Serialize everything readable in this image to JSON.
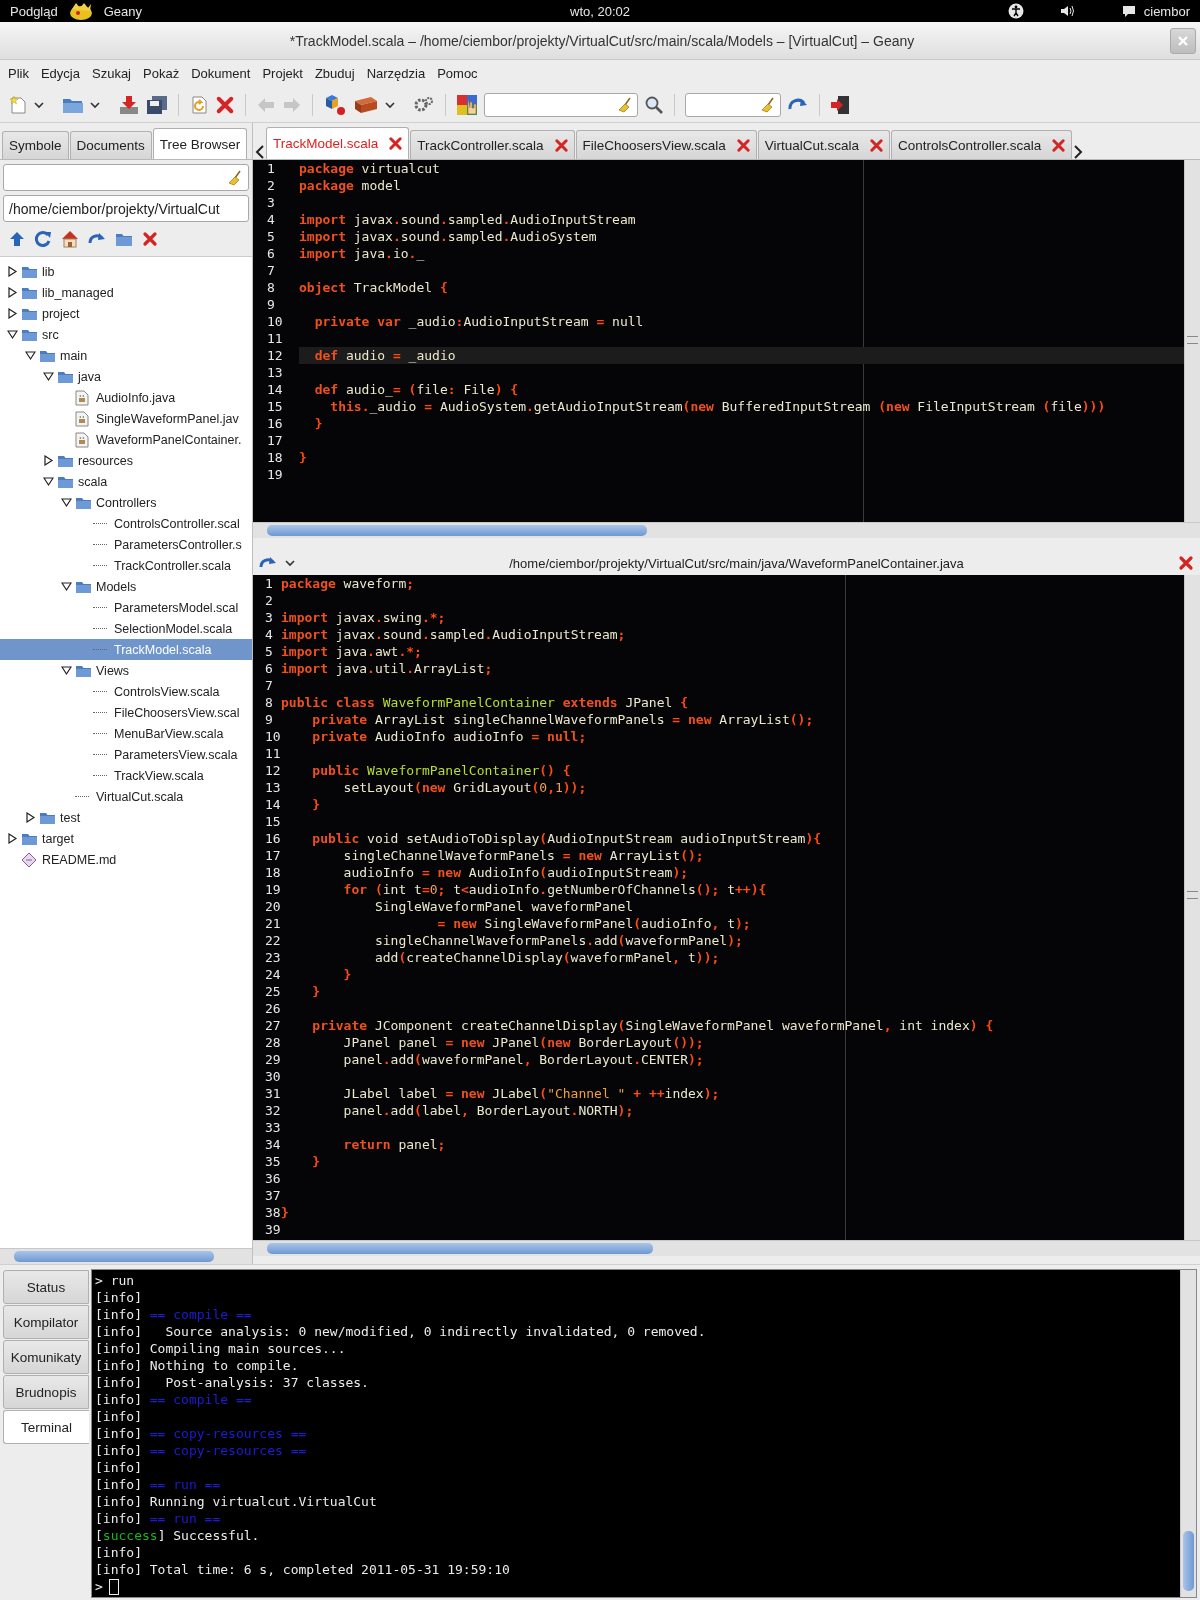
{
  "top_bar": {
    "activities": "Podgląd",
    "app_name": "Geany",
    "clock": "wto, 20:02",
    "user": "ciembor"
  },
  "window": {
    "title": "*TrackModel.scala – /home/ciembor/projekty/VirtualCut/src/main/scala/Models – [VirtualCut] – Geany"
  },
  "menu": [
    "Plik",
    "Edycja",
    "Szukaj",
    "Pokaż",
    "Dokument",
    "Projekt",
    "Zbuduj",
    "Narzędzia",
    "Pomoc"
  ],
  "sidebar": {
    "tabs": [
      {
        "label": "Symbole",
        "selected": false
      },
      {
        "label": "Documents",
        "selected": false
      },
      {
        "label": "Tree Browser",
        "selected": true
      }
    ],
    "path": "/home/ciembor/projekty/VirtualCut",
    "tree": [
      {
        "label": "lib",
        "kind": "folder",
        "expanded": false,
        "selected": false
      },
      {
        "label": "lib_managed",
        "kind": "folder",
        "expanded": false,
        "selected": false
      },
      {
        "label": "project",
        "kind": "folder",
        "expanded": false,
        "selected": false
      },
      {
        "label": "src",
        "kind": "folder",
        "expanded": true,
        "selected": false,
        "children": [
          {
            "label": "main",
            "kind": "folder",
            "expanded": true,
            "selected": false,
            "children": [
              {
                "label": "java",
                "kind": "folder",
                "expanded": true,
                "selected": false,
                "children": [
                  {
                    "label": "AudioInfo.java",
                    "kind": "java",
                    "selected": false
                  },
                  {
                    "label": "SingleWaveformPanel.jav",
                    "kind": "java",
                    "selected": false
                  },
                  {
                    "label": "WaveformPanelContainer.",
                    "kind": "java",
                    "selected": false
                  }
                ]
              },
              {
                "label": "resources",
                "kind": "folder",
                "expanded": false,
                "selected": false
              },
              {
                "label": "scala",
                "kind": "folder",
                "expanded": true,
                "selected": false,
                "children": [
                  {
                    "label": "Controllers",
                    "kind": "folder",
                    "expanded": true,
                    "selected": false,
                    "children": [
                      {
                        "label": "ControlsController.scal",
                        "kind": "scala",
                        "selected": false
                      },
                      {
                        "label": "ParametersController.s",
                        "kind": "scala",
                        "selected": false
                      },
                      {
                        "label": "TrackController.scala",
                        "kind": "scala",
                        "selected": false
                      }
                    ]
                  },
                  {
                    "label": "Models",
                    "kind": "folder",
                    "expanded": true,
                    "selected": false,
                    "children": [
                      {
                        "label": "ParametersModel.scal",
                        "kind": "scala",
                        "selected": false
                      },
                      {
                        "label": "SelectionModel.scala",
                        "kind": "scala",
                        "selected": false
                      },
                      {
                        "label": "TrackModel.scala",
                        "kind": "scala",
                        "selected": true
                      }
                    ]
                  },
                  {
                    "label": "Views",
                    "kind": "folder",
                    "expanded": true,
                    "selected": false,
                    "children": [
                      {
                        "label": "ControlsView.scala",
                        "kind": "scala",
                        "selected": false
                      },
                      {
                        "label": "FileChoosersView.scal",
                        "kind": "scala",
                        "selected": false
                      },
                      {
                        "label": "MenuBarView.scala",
                        "kind": "scala",
                        "selected": false
                      },
                      {
                        "label": "ParametersView.scala",
                        "kind": "scala",
                        "selected": false
                      },
                      {
                        "label": "TrackView.scala",
                        "kind": "scala",
                        "selected": false
                      }
                    ]
                  },
                  {
                    "label": "VirtualCut.scala",
                    "kind": "scala",
                    "selected": false
                  }
                ]
              }
            ]
          },
          {
            "label": "test",
            "kind": "folder",
            "expanded": false,
            "selected": false
          }
        ]
      },
      {
        "label": "target",
        "kind": "folder",
        "expanded": false,
        "selected": false
      },
      {
        "label": "README.md",
        "kind": "markdown",
        "selected": false
      }
    ]
  },
  "editor_tabs": [
    {
      "label": "TrackModel.scala",
      "selected": true,
      "modified": true
    },
    {
      "label": "TrackController.scala",
      "selected": false,
      "modified": false
    },
    {
      "label": "FileChoosersView.scala",
      "selected": false,
      "modified": false
    },
    {
      "label": "VirtualCut.scala",
      "selected": false,
      "modified": false
    },
    {
      "label": "ControlsController.scala",
      "selected": false,
      "modified": false
    }
  ],
  "editor": {
    "lines": [
      {
        "number": "1",
        "current": false,
        "tokens": [
          {
            "kind": "keyword",
            "text": "package"
          },
          {
            "kind": "plain",
            "text": " virtualcut"
          }
        ]
      },
      {
        "number": "2",
        "current": false,
        "tokens": [
          {
            "kind": "keyword",
            "text": "package"
          },
          {
            "kind": "plain",
            "text": " model"
          }
        ]
      },
      {
        "number": "3",
        "current": false
      },
      {
        "number": "4",
        "current": false,
        "tokens": [
          {
            "kind": "keyword",
            "text": "import"
          },
          {
            "kind": "plain",
            "text": " javax"
          },
          {
            "kind": "punct",
            "text": "."
          },
          {
            "kind": "plain",
            "text": "sound"
          },
          {
            "kind": "punct",
            "text": "."
          },
          {
            "kind": "plain",
            "text": "sampled"
          },
          {
            "kind": "punct",
            "text": "."
          },
          {
            "kind": "plain",
            "text": "AudioInputStream"
          }
        ]
      },
      {
        "number": "5",
        "current": false,
        "tokens": [
          {
            "kind": "keyword",
            "text": "import"
          },
          {
            "kind": "plain",
            "text": " javax"
          },
          {
            "kind": "punct",
            "text": "."
          },
          {
            "kind": "plain",
            "text": "sound"
          },
          {
            "kind": "punct",
            "text": "."
          },
          {
            "kind": "plain",
            "text": "sampled"
          },
          {
            "kind": "punct",
            "text": "."
          },
          {
            "kind": "plain",
            "text": "AudioSystem"
          }
        ]
      },
      {
        "number": "6",
        "current": false,
        "tokens": [
          {
            "kind": "keyword",
            "text": "import"
          },
          {
            "kind": "plain",
            "text": " java"
          },
          {
            "kind": "punct",
            "text": "."
          },
          {
            "kind": "plain",
            "text": "io"
          },
          {
            "kind": "punct",
            "text": "."
          },
          {
            "kind": "plain",
            "text": "_"
          }
        ]
      },
      {
        "number": "7",
        "current": false
      },
      {
        "number": "8",
        "current": false,
        "tokens": [
          {
            "kind": "keyword",
            "text": "object"
          },
          {
            "kind": "plain",
            "text": " TrackModel "
          },
          {
            "kind": "punct",
            "text": "{"
          }
        ]
      },
      {
        "number": "9",
        "current": false
      },
      {
        "number": "10",
        "current": false,
        "tokens": [
          {
            "kind": "keyword",
            "text": "  private var"
          },
          {
            "kind": "plain",
            "text": " _audio"
          },
          {
            "kind": "punct",
            "text": ":"
          },
          {
            "kind": "plain",
            "text": "AudioInputStream "
          },
          {
            "kind": "punct",
            "text": "="
          },
          {
            "kind": "plain",
            "text": " null"
          }
        ]
      },
      {
        "number": "11",
        "current": false
      },
      {
        "number": "12",
        "current": true,
        "tokens": [
          {
            "kind": "keyword",
            "text": "  def"
          },
          {
            "kind": "plain",
            "text": " audio "
          },
          {
            "kind": "punct",
            "text": "="
          },
          {
            "kind": "plain",
            "text": " _audio"
          }
        ]
      },
      {
        "number": "13",
        "current": false
      },
      {
        "number": "14",
        "current": false,
        "tokens": [
          {
            "kind": "keyword",
            "text": "  def"
          },
          {
            "kind": "plain",
            "text": " audio_"
          },
          {
            "kind": "punct",
            "text": "= ("
          },
          {
            "kind": "plain",
            "text": "file"
          },
          {
            "kind": "punct",
            "text": ":"
          },
          {
            "kind": "plain",
            "text": " File"
          },
          {
            "kind": "punct",
            "text": ") {"
          }
        ]
      },
      {
        "number": "15",
        "current": false,
        "tokens": [
          {
            "kind": "keyword",
            "text": "    this"
          },
          {
            "kind": "punct",
            "text": "."
          },
          {
            "kind": "plain",
            "text": "_audio "
          },
          {
            "kind": "punct",
            "text": "="
          },
          {
            "kind": "plain",
            "text": " AudioSystem"
          },
          {
            "kind": "punct",
            "text": "."
          },
          {
            "kind": "plain",
            "text": "getAudioInputStream"
          },
          {
            "kind": "punct",
            "text": "("
          },
          {
            "kind": "keyword",
            "text": "new"
          },
          {
            "kind": "plain",
            "text": " BufferedInputStream "
          },
          {
            "kind": "punct",
            "text": "("
          },
          {
            "kind": "keyword",
            "text": "new"
          },
          {
            "kind": "plain",
            "text": " FileInputStream "
          },
          {
            "kind": "punct",
            "text": "("
          },
          {
            "kind": "plain",
            "text": "file"
          },
          {
            "kind": "punct",
            "text": ")))"
          }
        ]
      },
      {
        "number": "16",
        "current": false,
        "tokens": [
          {
            "kind": "punct",
            "text": "  }"
          }
        ]
      },
      {
        "number": "17",
        "current": false
      },
      {
        "number": "18",
        "current": false,
        "tokens": [
          {
            "kind": "punct",
            "text": "}"
          }
        ]
      },
      {
        "number": "19",
        "current": false
      }
    ]
  },
  "split_editor": {
    "path": "/home/ciembor/projekty/VirtualCut/src/main/java/WaveformPanelContainer.java",
    "lines": [
      {
        "number": "1",
        "tokens": [
          {
            "kind": "keyword",
            "text": "package"
          },
          {
            "kind": "plain",
            "text": " waveform"
          },
          {
            "kind": "punct",
            "text": ";"
          }
        ]
      },
      {
        "number": "2"
      },
      {
        "number": "3",
        "tokens": [
          {
            "kind": "keyword",
            "text": "import"
          },
          {
            "kind": "plain",
            "text": " javax"
          },
          {
            "kind": "punct",
            "text": "."
          },
          {
            "kind": "plain",
            "text": "swing"
          },
          {
            "kind": "punct",
            "text": ".*;"
          }
        ]
      },
      {
        "number": "4",
        "tokens": [
          {
            "kind": "keyword",
            "text": "import"
          },
          {
            "kind": "plain",
            "text": " javax"
          },
          {
            "kind": "punct",
            "text": "."
          },
          {
            "kind": "plain",
            "text": "sound"
          },
          {
            "kind": "punct",
            "text": "."
          },
          {
            "kind": "plain",
            "text": "sampled"
          },
          {
            "kind": "punct",
            "text": "."
          },
          {
            "kind": "plain",
            "text": "AudioInputStream"
          },
          {
            "kind": "punct",
            "text": ";"
          }
        ]
      },
      {
        "number": "5",
        "tokens": [
          {
            "kind": "keyword",
            "text": "import"
          },
          {
            "kind": "plain",
            "text": " java"
          },
          {
            "kind": "punct",
            "text": "."
          },
          {
            "kind": "plain",
            "text": "awt"
          },
          {
            "kind": "punct",
            "text": ".*;"
          }
        ]
      },
      {
        "number": "6",
        "tokens": [
          {
            "kind": "keyword",
            "text": "import"
          },
          {
            "kind": "plain",
            "text": " java"
          },
          {
            "kind": "punct",
            "text": "."
          },
          {
            "kind": "plain",
            "text": "util"
          },
          {
            "kind": "punct",
            "text": "."
          },
          {
            "kind": "plain",
            "text": "ArrayList"
          },
          {
            "kind": "punct",
            "text": ";"
          }
        ]
      },
      {
        "number": "7"
      },
      {
        "number": "8",
        "tokens": [
          {
            "kind": "keyword",
            "text": "public class"
          },
          {
            "kind": "type",
            "text": " WaveformPanelContainer"
          },
          {
            "kind": "keyword",
            "text": " extends"
          },
          {
            "kind": "plain",
            "text": " JPanel "
          },
          {
            "kind": "punct",
            "text": "{"
          }
        ]
      },
      {
        "number": "9",
        "tokens": [
          {
            "kind": "keyword",
            "text": "    private"
          },
          {
            "kind": "plain",
            "text": " ArrayList singleChannelWaveformPanels "
          },
          {
            "kind": "punct",
            "text": "="
          },
          {
            "kind": "keyword",
            "text": " new"
          },
          {
            "kind": "plain",
            "text": " ArrayList"
          },
          {
            "kind": "punct",
            "text": "();"
          }
        ]
      },
      {
        "number": "10",
        "tokens": [
          {
            "kind": "keyword",
            "text": "    private"
          },
          {
            "kind": "plain",
            "text": " AudioInfo audioInfo "
          },
          {
            "kind": "punct",
            "text": "="
          },
          {
            "kind": "keyword",
            "text": " null"
          },
          {
            "kind": "punct",
            "text": ";"
          }
        ]
      },
      {
        "number": "11"
      },
      {
        "number": "12",
        "tokens": [
          {
            "kind": "keyword",
            "text": "    public"
          },
          {
            "kind": "type",
            "text": " WaveformPanelContainer"
          },
          {
            "kind": "punct",
            "text": "() {"
          }
        ]
      },
      {
        "number": "13",
        "tokens": [
          {
            "kind": "plain",
            "text": "        setLayout"
          },
          {
            "kind": "punct",
            "text": "("
          },
          {
            "kind": "keyword",
            "text": "new"
          },
          {
            "kind": "plain",
            "text": " GridLayout"
          },
          {
            "kind": "punct",
            "text": "("
          },
          {
            "kind": "number",
            "text": "0"
          },
          {
            "kind": "punct",
            "text": ","
          },
          {
            "kind": "number",
            "text": "1"
          },
          {
            "kind": "punct",
            "text": "));"
          }
        ]
      },
      {
        "number": "14",
        "tokens": [
          {
            "kind": "punct",
            "text": "    }"
          }
        ]
      },
      {
        "number": "15"
      },
      {
        "number": "16",
        "tokens": [
          {
            "kind": "keyword",
            "text": "    public"
          },
          {
            "kind": "plain",
            "text": " void setAudioToDisplay"
          },
          {
            "kind": "punct",
            "text": "("
          },
          {
            "kind": "plain",
            "text": "AudioInputStream audioInputStream"
          },
          {
            "kind": "punct",
            "text": "){"
          }
        ]
      },
      {
        "number": "17",
        "tokens": [
          {
            "kind": "plain",
            "text": "        singleChannelWaveformPanels "
          },
          {
            "kind": "punct",
            "text": "="
          },
          {
            "kind": "keyword",
            "text": " new"
          },
          {
            "kind": "plain",
            "text": " ArrayList"
          },
          {
            "kind": "punct",
            "text": "();"
          }
        ]
      },
      {
        "number": "18",
        "tokens": [
          {
            "kind": "plain",
            "text": "        audioInfo "
          },
          {
            "kind": "punct",
            "text": "="
          },
          {
            "kind": "keyword",
            "text": " new"
          },
          {
            "kind": "plain",
            "text": " AudioInfo"
          },
          {
            "kind": "punct",
            "text": "("
          },
          {
            "kind": "plain",
            "text": "audioInputStream"
          },
          {
            "kind": "punct",
            "text": ");"
          }
        ]
      },
      {
        "number": "19",
        "tokens": [
          {
            "kind": "keyword",
            "text": "        for"
          },
          {
            "kind": "punct",
            "text": " ("
          },
          {
            "kind": "plain",
            "text": "int t"
          },
          {
            "kind": "punct",
            "text": "="
          },
          {
            "kind": "number",
            "text": "0"
          },
          {
            "kind": "punct",
            "text": ";"
          },
          {
            "kind": "plain",
            "text": " t"
          },
          {
            "kind": "punct",
            "text": "<"
          },
          {
            "kind": "plain",
            "text": "audioInfo"
          },
          {
            "kind": "punct",
            "text": "."
          },
          {
            "kind": "plain",
            "text": "getNumberOfChannels"
          },
          {
            "kind": "punct",
            "text": "();"
          },
          {
            "kind": "plain",
            "text": " t"
          },
          {
            "kind": "punct",
            "text": "++){"
          }
        ]
      },
      {
        "number": "20",
        "tokens": [
          {
            "kind": "plain",
            "text": "            SingleWaveformPanel waveformPanel"
          }
        ]
      },
      {
        "number": "21",
        "tokens": [
          {
            "kind": "punct",
            "text": "                    ="
          },
          {
            "kind": "keyword",
            "text": " new"
          },
          {
            "kind": "plain",
            "text": " SingleWaveformPanel"
          },
          {
            "kind": "punct",
            "text": "("
          },
          {
            "kind": "plain",
            "text": "audioInfo"
          },
          {
            "kind": "punct",
            "text": ","
          },
          {
            "kind": "plain",
            "text": " t"
          },
          {
            "kind": "punct",
            "text": ");"
          }
        ]
      },
      {
        "number": "22",
        "tokens": [
          {
            "kind": "plain",
            "text": "            singleChannelWaveformPanels"
          },
          {
            "kind": "punct",
            "text": "."
          },
          {
            "kind": "plain",
            "text": "add"
          },
          {
            "kind": "punct",
            "text": "("
          },
          {
            "kind": "plain",
            "text": "waveformPanel"
          },
          {
            "kind": "punct",
            "text": ");"
          }
        ]
      },
      {
        "number": "23",
        "tokens": [
          {
            "kind": "plain",
            "text": "            add"
          },
          {
            "kind": "punct",
            "text": "("
          },
          {
            "kind": "plain",
            "text": "createChannelDisplay"
          },
          {
            "kind": "punct",
            "text": "("
          },
          {
            "kind": "plain",
            "text": "waveformPanel"
          },
          {
            "kind": "punct",
            "text": ","
          },
          {
            "kind": "plain",
            "text": " t"
          },
          {
            "kind": "punct",
            "text": "));"
          }
        ]
      },
      {
        "number": "24",
        "tokens": [
          {
            "kind": "punct",
            "text": "        }"
          }
        ]
      },
      {
        "number": "25",
        "tokens": [
          {
            "kind": "punct",
            "text": "    }"
          }
        ]
      },
      {
        "number": "26"
      },
      {
        "number": "27",
        "tokens": [
          {
            "kind": "keyword",
            "text": "    private"
          },
          {
            "kind": "plain",
            "text": " JComponent createChannelDisplay"
          },
          {
            "kind": "punct",
            "text": "("
          },
          {
            "kind": "plain",
            "text": "SingleWaveformPanel waveformPanel"
          },
          {
            "kind": "punct",
            "text": ","
          },
          {
            "kind": "plain",
            "text": " int index"
          },
          {
            "kind": "punct",
            "text": ") {"
          }
        ]
      },
      {
        "number": "28",
        "tokens": [
          {
            "kind": "plain",
            "text": "        JPanel panel "
          },
          {
            "kind": "punct",
            "text": "="
          },
          {
            "kind": "keyword",
            "text": " new"
          },
          {
            "kind": "plain",
            "text": " JPanel"
          },
          {
            "kind": "punct",
            "text": "("
          },
          {
            "kind": "keyword",
            "text": "new"
          },
          {
            "kind": "plain",
            "text": " BorderLayout"
          },
          {
            "kind": "punct",
            "text": "());"
          }
        ]
      },
      {
        "number": "29",
        "tokens": [
          {
            "kind": "plain",
            "text": "        panel"
          },
          {
            "kind": "punct",
            "text": "."
          },
          {
            "kind": "plain",
            "text": "add"
          },
          {
            "kind": "punct",
            "text": "("
          },
          {
            "kind": "plain",
            "text": "waveformPanel"
          },
          {
            "kind": "punct",
            "text": ","
          },
          {
            "kind": "plain",
            "text": " BorderLayout"
          },
          {
            "kind": "punct",
            "text": "."
          },
          {
            "kind": "plain",
            "text": "CENTER"
          },
          {
            "kind": "punct",
            "text": ");"
          }
        ]
      },
      {
        "number": "30"
      },
      {
        "number": "31",
        "tokens": [
          {
            "kind": "plain",
            "text": "        JLabel label "
          },
          {
            "kind": "punct",
            "text": "="
          },
          {
            "kind": "keyword",
            "text": " new"
          },
          {
            "kind": "plain",
            "text": " JLabel"
          },
          {
            "kind": "punct",
            "text": "("
          },
          {
            "kind": "string",
            "text": "\"Channel \""
          },
          {
            "kind": "punct",
            "text": " + ++"
          },
          {
            "kind": "plain",
            "text": "index"
          },
          {
            "kind": "punct",
            "text": ");"
          }
        ]
      },
      {
        "number": "32",
        "tokens": [
          {
            "kind": "plain",
            "text": "        panel"
          },
          {
            "kind": "punct",
            "text": "."
          },
          {
            "kind": "plain",
            "text": "add"
          },
          {
            "kind": "punct",
            "text": "("
          },
          {
            "kind": "plain",
            "text": "label"
          },
          {
            "kind": "punct",
            "text": ","
          },
          {
            "kind": "plain",
            "text": " BorderLayout"
          },
          {
            "kind": "punct",
            "text": "."
          },
          {
            "kind": "plain",
            "text": "NORTH"
          },
          {
            "kind": "punct",
            "text": ");"
          }
        ]
      },
      {
        "number": "33"
      },
      {
        "number": "34",
        "tokens": [
          {
            "kind": "keyword",
            "text": "        return"
          },
          {
            "kind": "plain",
            "text": " panel"
          },
          {
            "kind": "punct",
            "text": ";"
          }
        ]
      },
      {
        "number": "35",
        "tokens": [
          {
            "kind": "punct",
            "text": "    }"
          }
        ]
      },
      {
        "number": "36"
      },
      {
        "number": "37"
      },
      {
        "number": "38",
        "tokens": [
          {
            "kind": "punct",
            "text": "}"
          }
        ]
      },
      {
        "number": "39"
      }
    ]
  },
  "message_tabs": [
    {
      "label": "Status",
      "selected": false
    },
    {
      "label": "Kompilator",
      "selected": false
    },
    {
      "label": "Komunikaty",
      "selected": false
    },
    {
      "label": "Brudnopis",
      "selected": false
    },
    {
      "label": "Terminal",
      "selected": true
    }
  ],
  "terminal": {
    "lines": [
      [
        {
          "kind": "plain",
          "text": "> run"
        }
      ],
      [
        {
          "kind": "plain",
          "text": "[info]"
        }
      ],
      [
        {
          "kind": "plain",
          "text": "[info] "
        },
        {
          "kind": "section",
          "text": "== compile =="
        }
      ],
      [
        {
          "kind": "plain",
          "text": "[info]   Source analysis: 0 new/modified, 0 indirectly invalidated, 0 removed."
        }
      ],
      [
        {
          "kind": "plain",
          "text": "[info] Compiling main sources..."
        }
      ],
      [
        {
          "kind": "plain",
          "text": "[info] Nothing to compile."
        }
      ],
      [
        {
          "kind": "plain",
          "text": "[info]   Post-analysis: 37 classes."
        }
      ],
      [
        {
          "kind": "plain",
          "text": "[info] "
        },
        {
          "kind": "section",
          "text": "== compile =="
        }
      ],
      [
        {
          "kind": "plain",
          "text": "[info]"
        }
      ],
      [
        {
          "kind": "plain",
          "text": "[info] "
        },
        {
          "kind": "section",
          "text": "== copy-resources =="
        }
      ],
      [
        {
          "kind": "plain",
          "text": "[info] "
        },
        {
          "kind": "section",
          "text": "== copy-resources =="
        }
      ],
      [
        {
          "kind": "plain",
          "text": "[info]"
        }
      ],
      [
        {
          "kind": "plain",
          "text": "[info] "
        },
        {
          "kind": "section",
          "text": "== run =="
        }
      ],
      [
        {
          "kind": "plain",
          "text": "[info] Running virtualcut.VirtualCut"
        }
      ],
      [
        {
          "kind": "plain",
          "text": "[info] "
        },
        {
          "kind": "section",
          "text": "== run =="
        }
      ],
      [
        {
          "kind": "plain",
          "text": "["
        },
        {
          "kind": "success",
          "text": "success"
        },
        {
          "kind": "plain",
          "text": "] Successful."
        }
      ],
      [
        {
          "kind": "plain",
          "text": "[info]"
        }
      ],
      [
        {
          "kind": "plain",
          "text": "[info] Total time: 6 s, completed 2011-05-31 19:59:10"
        }
      ]
    ],
    "prompt": ">"
  }
}
